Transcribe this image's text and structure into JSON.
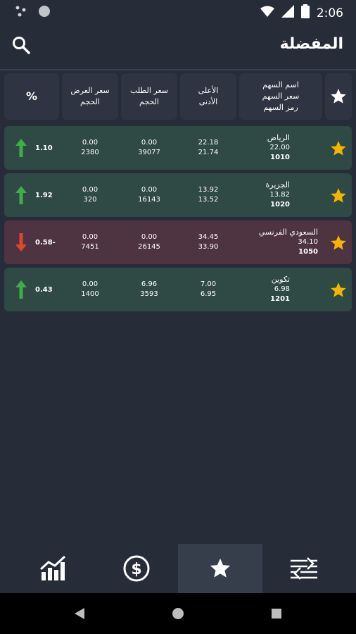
{
  "status": {
    "time": "2:06"
  },
  "appbar": {
    "title": "المفضلة"
  },
  "header": {
    "name_col": [
      "اسم السهم",
      "سعر السهم",
      "رمز السهم"
    ],
    "highlow_col": [
      "الأعلى",
      "الأدنى"
    ],
    "bid_col": [
      "سعر الطلب",
      "الحجم"
    ],
    "ask_col": [
      "سعر العرض",
      "الحجم"
    ],
    "pct_col": "%"
  },
  "rows": [
    {
      "name": "الرياض",
      "price": "22.00",
      "code": "1010",
      "high": "22.18",
      "low": "21.74",
      "bid_price": "0.00",
      "bid_vol": "39077",
      "ask_price": "0.00",
      "ask_vol": "2380",
      "pct": "1.10",
      "dir": "up"
    },
    {
      "name": "الجزيرة",
      "price": "13.82",
      "code": "1020",
      "high": "13.92",
      "low": "13.52",
      "bid_price": "0.00",
      "bid_vol": "16143",
      "ask_price": "0.00",
      "ask_vol": "320",
      "pct": "1.92",
      "dir": "up"
    },
    {
      "name": "السعودي الفرنسي",
      "price": "34.10",
      "code": "1050",
      "high": "34.45",
      "low": "33.90",
      "bid_price": "0.00",
      "bid_vol": "26145",
      "ask_price": "0.00",
      "ask_vol": "7451",
      "pct": "0.58-",
      "dir": "down"
    },
    {
      "name": "تكوين",
      "price": "6.98",
      "code": "1201",
      "high": "7.00",
      "low": "6.95",
      "bid_price": "6.96",
      "bid_vol": "3593",
      "ask_price": "0.00",
      "ask_vol": "1400",
      "pct": "0.43",
      "dir": "up"
    }
  ],
  "colors": {
    "up_row": "#2f4944",
    "down_row": "#4e3440",
    "star": "#f4b400",
    "up_arrow": "#3fae49",
    "down_arrow": "#e0452f"
  },
  "bottom_nav": {
    "active": "favorites-tab"
  }
}
